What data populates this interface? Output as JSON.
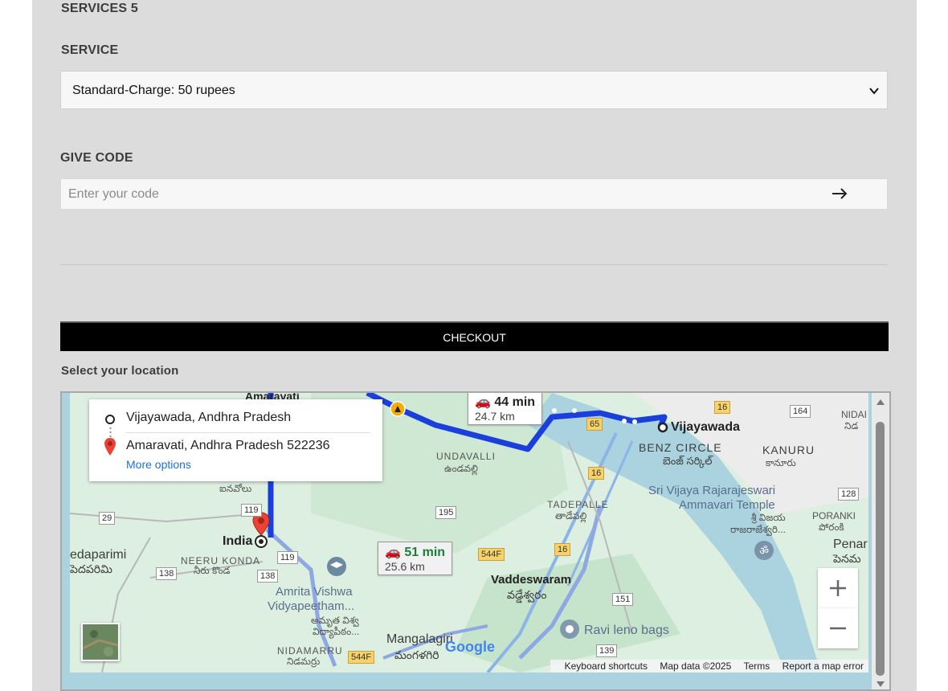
{
  "services_heading": "SERVICES 5",
  "service": {
    "label": "SERVICE",
    "selected": "Standard-Charge: 50 rupees"
  },
  "code": {
    "label": "GIVE CODE",
    "placeholder": "Enter your code",
    "submit_icon": "arrow-right-icon"
  },
  "checkout_label": "CHECKOUT",
  "location_label": "Select your location",
  "map": {
    "origin": "Vijayawada, Andhra Pradesh",
    "destination": "Amaravati, Andhra Pradesh 522236",
    "more_options": "More options",
    "route1": {
      "time": "44 min",
      "distance": "24.7 km"
    },
    "route2": {
      "time": "51 min",
      "distance": "25.6 km"
    },
    "labels": {
      "vijayawada": "Vijayawada",
      "benz_circle": "BENZ CIRCLE",
      "benz_circle_te": "బెంజ్ సర్కిల్",
      "kanuru": "KANURU",
      "kanuru_te": "కానూరు",
      "temple_line1": "Sri Vijaya Rajarajeswari",
      "temple_line2": "Ammavari Temple",
      "temple_te1": "శ్రీ విజయ",
      "temple_te2": "రాజరాజేశ్వరి...",
      "poranki": "PORANKI",
      "poranki_te": "పోరంకి",
      "penam": "Penar",
      "penam_te": "పెనమ",
      "nidam": "NIDAI",
      "nidam_te": "నిడ",
      "undavalli": "UNDAVALLI",
      "undavalli_te": "ఉండవల్లి",
      "tadepalle": "TADEPALLE",
      "tadepalle_te": "తాడేపల్లి",
      "vaddeswaram": "Vaddeswaram",
      "vaddeswaram_te": "వడ్డేశ్వరం",
      "ravi": "Ravi leno bags",
      "india": "India",
      "neerukonda": "NEERU KONDA",
      "neerukonda_te": "నీరు కొండ",
      "edaparimi": "edaparimi",
      "edaparimi_te": "పెదపరిమి",
      "amrita1": "Amrita Vishwa",
      "amrita2": "Vidyapeetham...",
      "amrita_te1": "అమృత విశ్వ",
      "amrita_te2": "విద్యాపీఠం...",
      "mangalagiri": "Mangalagiri",
      "mangalagiri_te": "మంగళగిరి",
      "nidamarru": "NIDAMARRU",
      "nidamarru_te": "నిడమర్రు",
      "amaravati": "Amaravati",
      "inavolu_te": "ఐనవోలు",
      "google": "Google"
    },
    "shields": [
      "16",
      "65",
      "16",
      "164",
      "128",
      "195",
      "544F",
      "16",
      "151",
      "139",
      "29",
      "119",
      "119",
      "138",
      "138",
      "544F"
    ],
    "attribution": {
      "shortcuts": "Keyboard shortcuts",
      "data": "Map data ©2025",
      "terms": "Terms",
      "report": "Report a map error"
    }
  }
}
